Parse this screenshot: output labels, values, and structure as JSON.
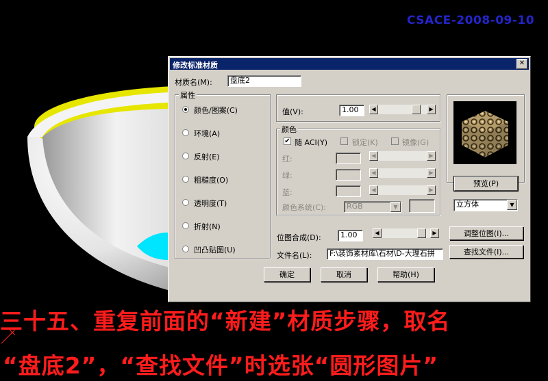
{
  "watermark": "CSACE-2008-09-10",
  "dialog": {
    "title": "修改标准材质",
    "close_glyph": "✕",
    "material_name_label": "材质名(M):",
    "material_name_value": "盘底2",
    "attributes_group": "属性",
    "attributes": [
      {
        "label": "颜色/图案(C)",
        "selected": true
      },
      {
        "label": "环境(A)",
        "selected": false
      },
      {
        "label": "反射(E)",
        "selected": false
      },
      {
        "label": "粗糙度(O)",
        "selected": false
      },
      {
        "label": "透明度(T)",
        "selected": false
      },
      {
        "label": "折射(N)",
        "selected": false
      },
      {
        "label": "凹凸贴图(U)",
        "selected": false
      }
    ],
    "value_label": "值(V):",
    "value": "1.00",
    "value_slider_position": 0.85,
    "color_group": "颜色",
    "by_aci_label": "随 ACI(Y)",
    "by_aci_checked": true,
    "lock_label": "锁定(K)",
    "mirror_label": "镜像(G)",
    "red_label": "红:",
    "green_label": "绿:",
    "blue_label": "蓝:",
    "color_system_label": "颜色系统(C):",
    "color_system_value": "RGB",
    "preview_button": "预览(P)",
    "preview_shape": "立方体",
    "bitmap_blend_label": "位图合成(D):",
    "bitmap_blend_value": "1.00",
    "bitmap_slider_position": 0.9,
    "adjust_bitmap_button": "调整位图(I)...",
    "file_name_label": "文件名(L):",
    "file_name_value": "F:\\装饰素材库\\石材\\D-大理石拼",
    "find_file_button": "查找文件(I)...",
    "ok_button": "确定",
    "cancel_button": "取消",
    "help_button": "帮助(H)"
  },
  "caption": {
    "line1": "三十五、重复前面的“新建”材质步骤，取名",
    "line2": "“盘底2”，“查找文件”时选张“圆形图片”"
  },
  "colors": {
    "caption": "#ff1c1c",
    "watermark": "#2424c8",
    "titlebar": "#0a246a",
    "dialog_bg": "#d4d0c8",
    "bowl_rim": "#e6e600",
    "bowl_bottom": "#00e5ff"
  }
}
